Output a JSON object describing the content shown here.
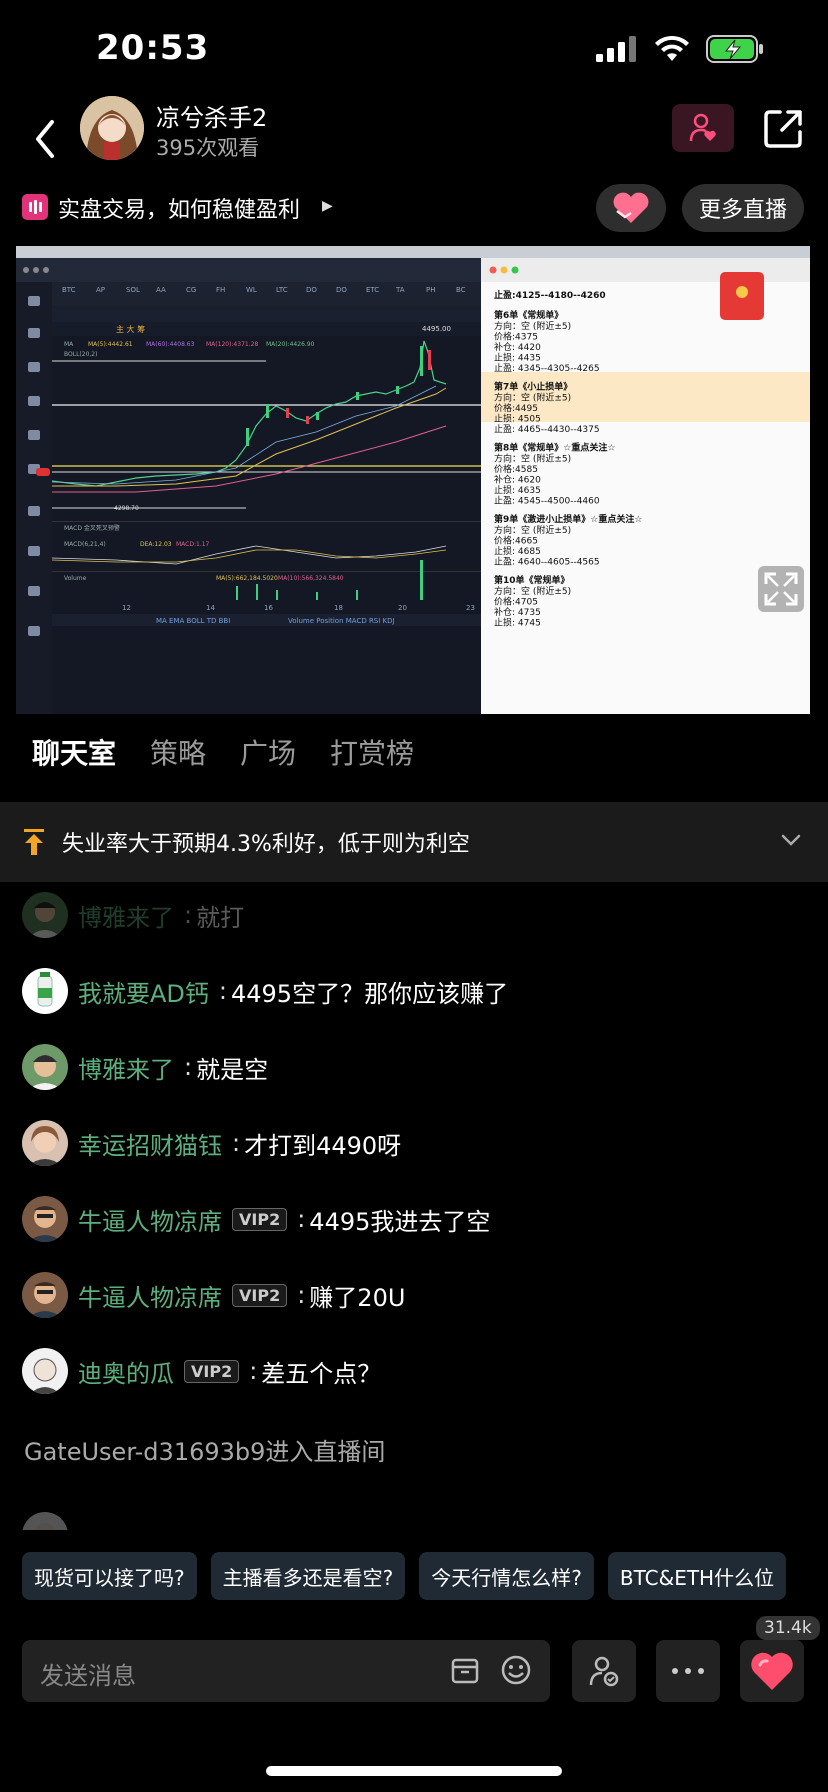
{
  "status": {
    "time": "20:53"
  },
  "header": {
    "streamer_name": "凉兮杀手2",
    "views": "395次观看"
  },
  "topic": {
    "title": "实盘交易，如何稳健盈利",
    "more_live": "更多直播"
  },
  "tabs": [
    {
      "label": "聊天室"
    },
    {
      "label": "策略"
    },
    {
      "label": "广场"
    },
    {
      "label": "打赏榜"
    }
  ],
  "announcement": {
    "text": "失业率大于预期4.3%利好，低于则为利空"
  },
  "video_panel": {
    "label": "4495.00",
    "low_label": "4298.70",
    "orders": [
      {
        "title": "第6单《常规单》",
        "lines": [
          "方向：空 (附近±5)",
          "价格:4375",
          "补仓: 4420",
          "止损: 4435",
          "止盈: 4345--4305--4265"
        ]
      },
      {
        "title": "第7单《小止损单》",
        "lines": [
          "方向：空 (附近±5)",
          "价格:4495",
          "止损: 4505",
          "止盈: 4465--4430--4375"
        ]
      },
      {
        "title": "第8单《常规单》☆重点关注☆",
        "lines": [
          "方向：空 (附近±5)",
          "价格:4585",
          "补仓: 4620",
          "止损: 4635",
          "止盈: 4545--4500--4460"
        ]
      },
      {
        "title": "第9单《激进小止损单》☆重点关注☆",
        "lines": [
          "方向：空 (附近±5)",
          "价格:4665",
          "止损: 4685",
          "止盈: 4640--4605--4565"
        ]
      },
      {
        "title": "第10单《常规单》",
        "lines": [
          "方向：空 (附近±5)",
          "价格:4705",
          "补仓: 4735",
          "止损: 4745"
        ]
      }
    ],
    "top_line": "止盈:4125--4180--4260"
  },
  "chat": [
    {
      "name": "博雅来了",
      "text": "就打",
      "vip": "",
      "faded": true
    },
    {
      "name": "我就要AD钙",
      "text": "4495空了？那你应该赚了",
      "vip": ""
    },
    {
      "name": "博雅来了",
      "text": "就是空",
      "vip": ""
    },
    {
      "name": "幸运招财猫钰",
      "text": "才打到4490呀",
      "vip": ""
    },
    {
      "name": "牛逼人物凉席",
      "text": "4495我进去了空",
      "vip": "VIP2"
    },
    {
      "name": "牛逼人物凉席",
      "text": "赚了20U",
      "vip": "VIP2"
    },
    {
      "name": "迪奥的瓜",
      "text": "差五个点？",
      "vip": "VIP2"
    }
  ],
  "system_message": "GateUser-d31693b9进入直播间",
  "quick_replies": [
    "现货可以接了吗?",
    "主播看多还是看空?",
    "今天行情怎么样?",
    "BTC&ETH什么位"
  ],
  "input": {
    "placeholder": "发送消息"
  },
  "likes": {
    "count": "31.4k"
  },
  "colors": {
    "accent_pink": "#e0337a",
    "name_green": "#5db07d",
    "heart_red": "#ff4d6d"
  },
  "icons": [
    "back-icon",
    "follow-icon",
    "share-icon",
    "heart-icon",
    "fullscreen-icon",
    "pin-icon",
    "chevron-down-icon",
    "box-icon",
    "emoji-icon",
    "guest-icon",
    "more-icon"
  ]
}
